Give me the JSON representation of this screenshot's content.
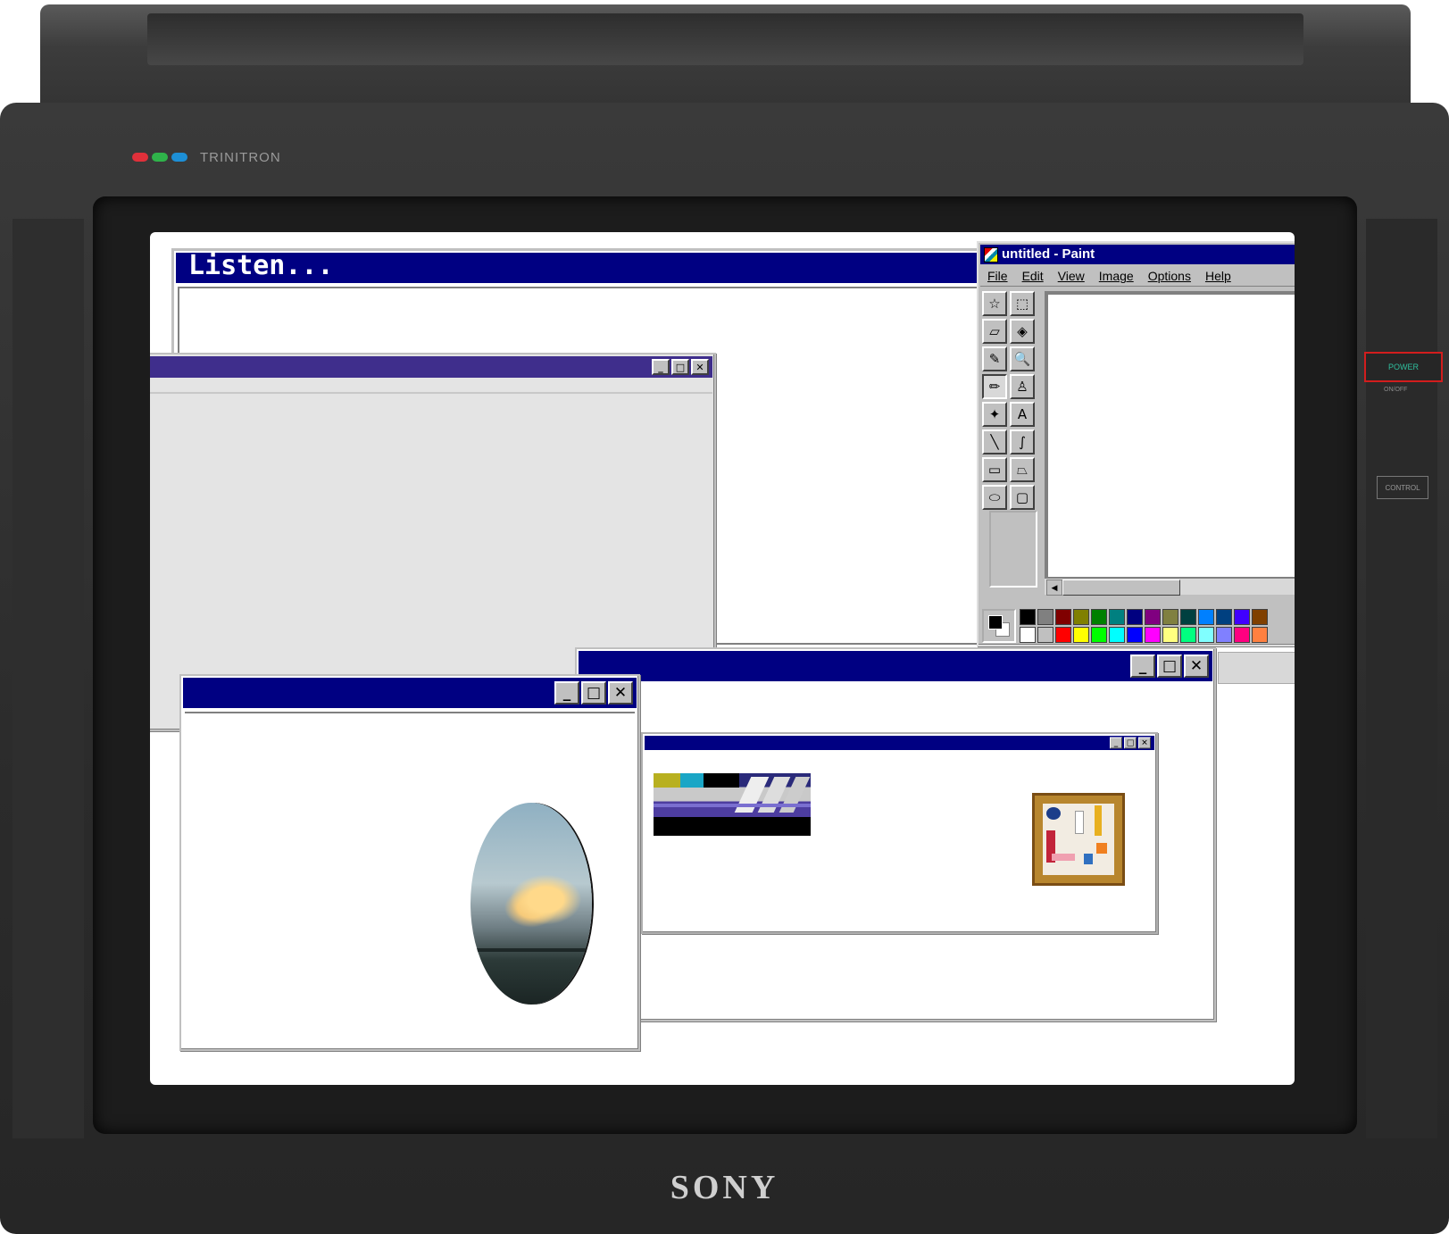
{
  "monitor": {
    "brand_badge": "TRINITRON",
    "brand_colors": [
      "#e0303a",
      "#2fb34a",
      "#1d8fd6"
    ],
    "power_label": "POWER",
    "power_sub_label": "ON/OFF",
    "control_label": "CONTROL",
    "maker": "SONY"
  },
  "listen_window": {
    "title": "Listen..."
  },
  "paint_window": {
    "title": "untitled - Paint",
    "menu": [
      "File",
      "Edit",
      "View",
      "Image",
      "Options",
      "Help"
    ],
    "tools": [
      {
        "name": "free-select-tool",
        "glyph": "☆"
      },
      {
        "name": "select-tool",
        "glyph": "⬚"
      },
      {
        "name": "eraser-tool",
        "glyph": "▱"
      },
      {
        "name": "fill-tool",
        "glyph": "◈"
      },
      {
        "name": "color-picker-tool",
        "glyph": "✎"
      },
      {
        "name": "magnifier-tool",
        "glyph": "🔍"
      },
      {
        "name": "pencil-tool",
        "glyph": "✏"
      },
      {
        "name": "brush-tool",
        "glyph": "♙"
      },
      {
        "name": "airbrush-tool",
        "glyph": "✦"
      },
      {
        "name": "text-tool",
        "glyph": "A"
      },
      {
        "name": "line-tool",
        "glyph": "╲"
      },
      {
        "name": "curve-tool",
        "glyph": "∫"
      },
      {
        "name": "rectangle-tool",
        "glyph": "▭"
      },
      {
        "name": "polygon-tool",
        "glyph": "⏢"
      },
      {
        "name": "ellipse-tool",
        "glyph": "⬭"
      },
      {
        "name": "rounded-rectangle-tool",
        "glyph": "▢"
      }
    ],
    "palette_row1": [
      "#000000",
      "#808080",
      "#800000",
      "#808000",
      "#008000",
      "#008080",
      "#000080",
      "#800080",
      "#808040",
      "#004040",
      "#0080ff",
      "#004080",
      "#4000ff",
      "#804000"
    ],
    "palette_row2": [
      "#ffffff",
      "#c0c0c0",
      "#ff0000",
      "#ffff00",
      "#00ff00",
      "#00ffff",
      "#0000ff",
      "#ff00ff",
      "#ffff80",
      "#00ff80",
      "#80ffff",
      "#8080ff",
      "#ff0080",
      "#ff8040"
    ],
    "foreground_color": "#000000",
    "background_color": "#ffffff"
  },
  "window_controls": {
    "minimize": "_",
    "maximize": "□",
    "close": "✕"
  }
}
